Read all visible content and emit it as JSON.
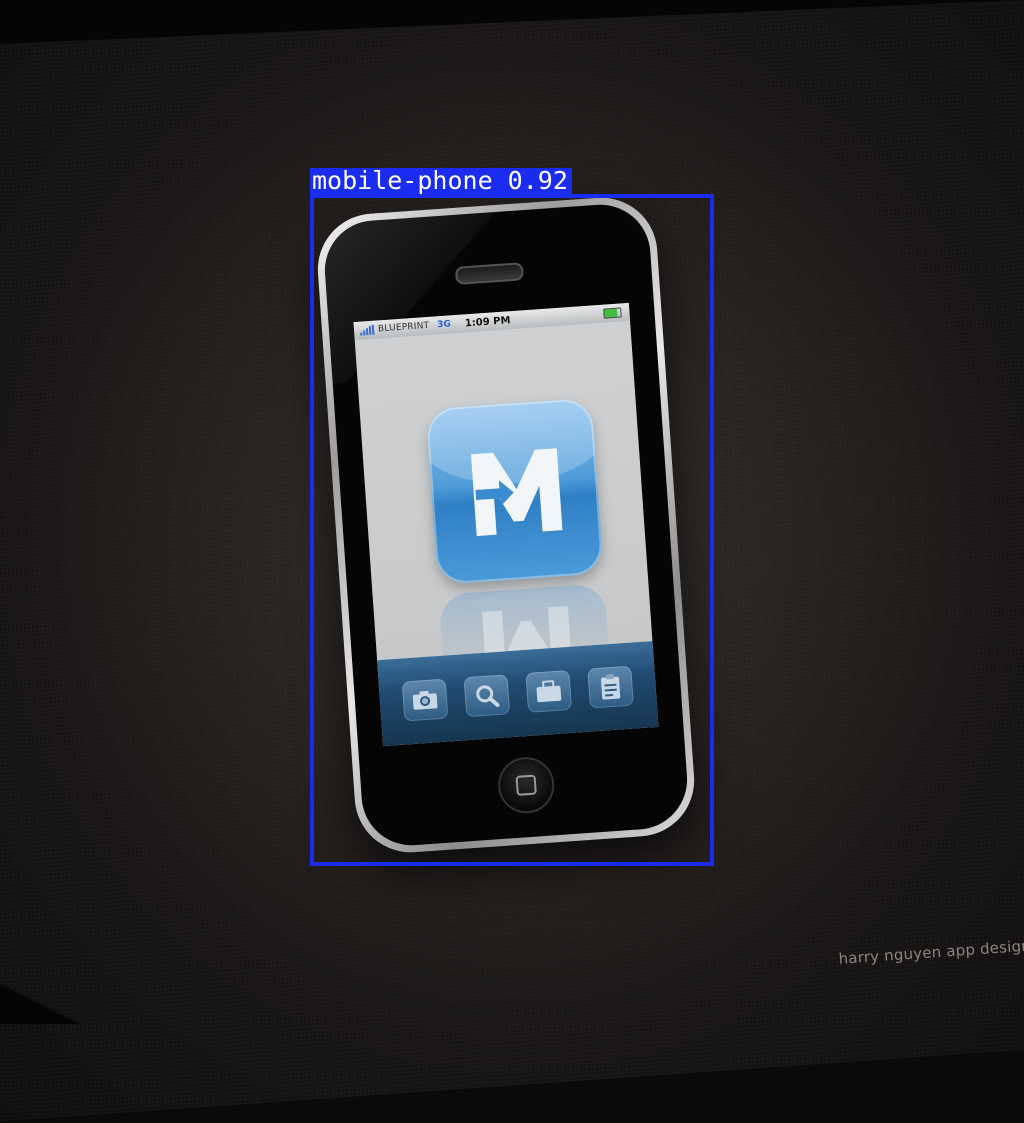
{
  "scene": {
    "credit_text": "harry nguyen app design",
    "background_color": "#2a2522"
  },
  "phone": {
    "statusbar": {
      "carrier": "BLUEPRINT",
      "network": "3G",
      "time": "1:09 PM"
    },
    "app_icon": {
      "name": "m-arrow-logo-icon",
      "color": "#4f9bd8"
    },
    "dock": [
      {
        "icon": "camera-icon"
      },
      {
        "icon": "search-icon"
      },
      {
        "icon": "briefcase-icon"
      },
      {
        "icon": "clipboard-icon"
      }
    ]
  },
  "detection": {
    "label": "mobile-phone 0.92",
    "class": "mobile-phone",
    "score": 0.92,
    "color": "#1a2cf0"
  }
}
